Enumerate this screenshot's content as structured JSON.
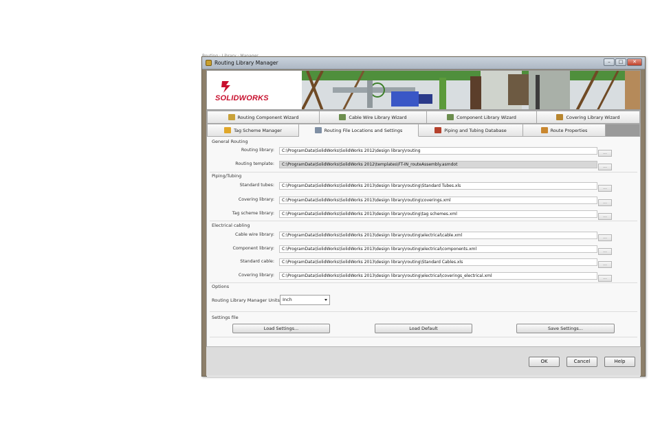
{
  "background_breadcrumb": "Routing · Library · Manager",
  "window": {
    "title": "Routing Library Manager",
    "controls": {
      "minimize": "–",
      "maximize": "□",
      "close": "✕"
    }
  },
  "brand": {
    "logo_text": "SOLIDWORKS",
    "accent_color": "#c8102e"
  },
  "tabs_top": [
    {
      "label": "Routing Component Wizard",
      "icon": "component-wizard-icon",
      "color": "#c9a23a"
    },
    {
      "label": "Cable Wire Library Wizard",
      "icon": "cable-wire-icon",
      "color": "#6c8e4e"
    },
    {
      "label": "Component Library Wizard",
      "icon": "component-library-icon",
      "color": "#6c8e4e"
    },
    {
      "label": "Covering Library Wizard",
      "icon": "covering-library-icon",
      "color": "#b8862f"
    }
  ],
  "tabs_bottom": [
    {
      "label": "Tag Scheme Manager",
      "icon": "tag-scheme-icon",
      "color": "#e0a72a"
    },
    {
      "label": "Routing File Locations and Settings",
      "icon": "file-settings-icon",
      "color": "#7f8fa4",
      "active": true
    },
    {
      "label": "Piping and Tubing Database",
      "icon": "piping-database-icon",
      "color": "#b5412c"
    },
    {
      "label": "Route Properties",
      "icon": "route-properties-icon",
      "color": "#c9872f"
    }
  ],
  "general_routing": {
    "label": "General Routing",
    "routing_library": {
      "label": "Routing library:",
      "value": "C:\\ProgramData\\SolidWorks\\SolidWorks 2012\\design library\\routing"
    },
    "routing_template": {
      "label": "Routing template:",
      "value": "C:\\ProgramData\\SolidWorks\\SolidWorks 2012\\templates\\FT-IN_routeAssembly.asmdot"
    }
  },
  "piping_tubing": {
    "label": "Piping/Tubing",
    "standard_tubes": {
      "label": "Standard tubes:",
      "value": "C:\\ProgramData\\SolidWorks\\SolidWorks 2013\\design library\\routing\\Standard Tubes.xls"
    },
    "covering_library": {
      "label": "Covering library:",
      "value": "C:\\ProgramData\\SolidWorks\\SolidWorks 2013\\design library\\routing\\coverings.xml"
    },
    "tag_scheme_library": {
      "label": "Tag scheme library:",
      "value": "C:\\ProgramData\\SolidWorks\\SolidWorks 2013\\design library\\routing\\tag schemes.xml"
    }
  },
  "electrical_cabling": {
    "label": "Electrical cabling",
    "cable_wire_library": {
      "label": "Cable wire library:",
      "value": "C:\\ProgramData\\SolidWorks\\SolidWorks 2013\\design library\\routing\\electrical\\cable.xml"
    },
    "component_library": {
      "label": "Component library:",
      "value": "C:\\ProgramData\\SolidWorks\\SolidWorks 2013\\design library\\routing\\electrical\\components.xml"
    },
    "standard_cable": {
      "label": "Standard cable:",
      "value": "C:\\ProgramData\\SolidWorks\\SolidWorks 2013\\design library\\routing\\Standard Cables.xls"
    },
    "covering_library": {
      "label": "Covering library:",
      "value": "C:\\ProgramData\\SolidWorks\\SolidWorks 2013\\design library\\routing\\electrical\\coverings_electrical.xml"
    }
  },
  "browse_label": "...",
  "options": {
    "label": "Options",
    "units_label": "Routing Library Manager Units:",
    "units_value": "Inch"
  },
  "settings_file": {
    "label": "Settings file",
    "load_settings": "Load Settings...",
    "load_default": "Load Default",
    "save_settings": "Save Settings..."
  },
  "footer": {
    "ok": "OK",
    "cancel": "Cancel",
    "help": "Help"
  }
}
